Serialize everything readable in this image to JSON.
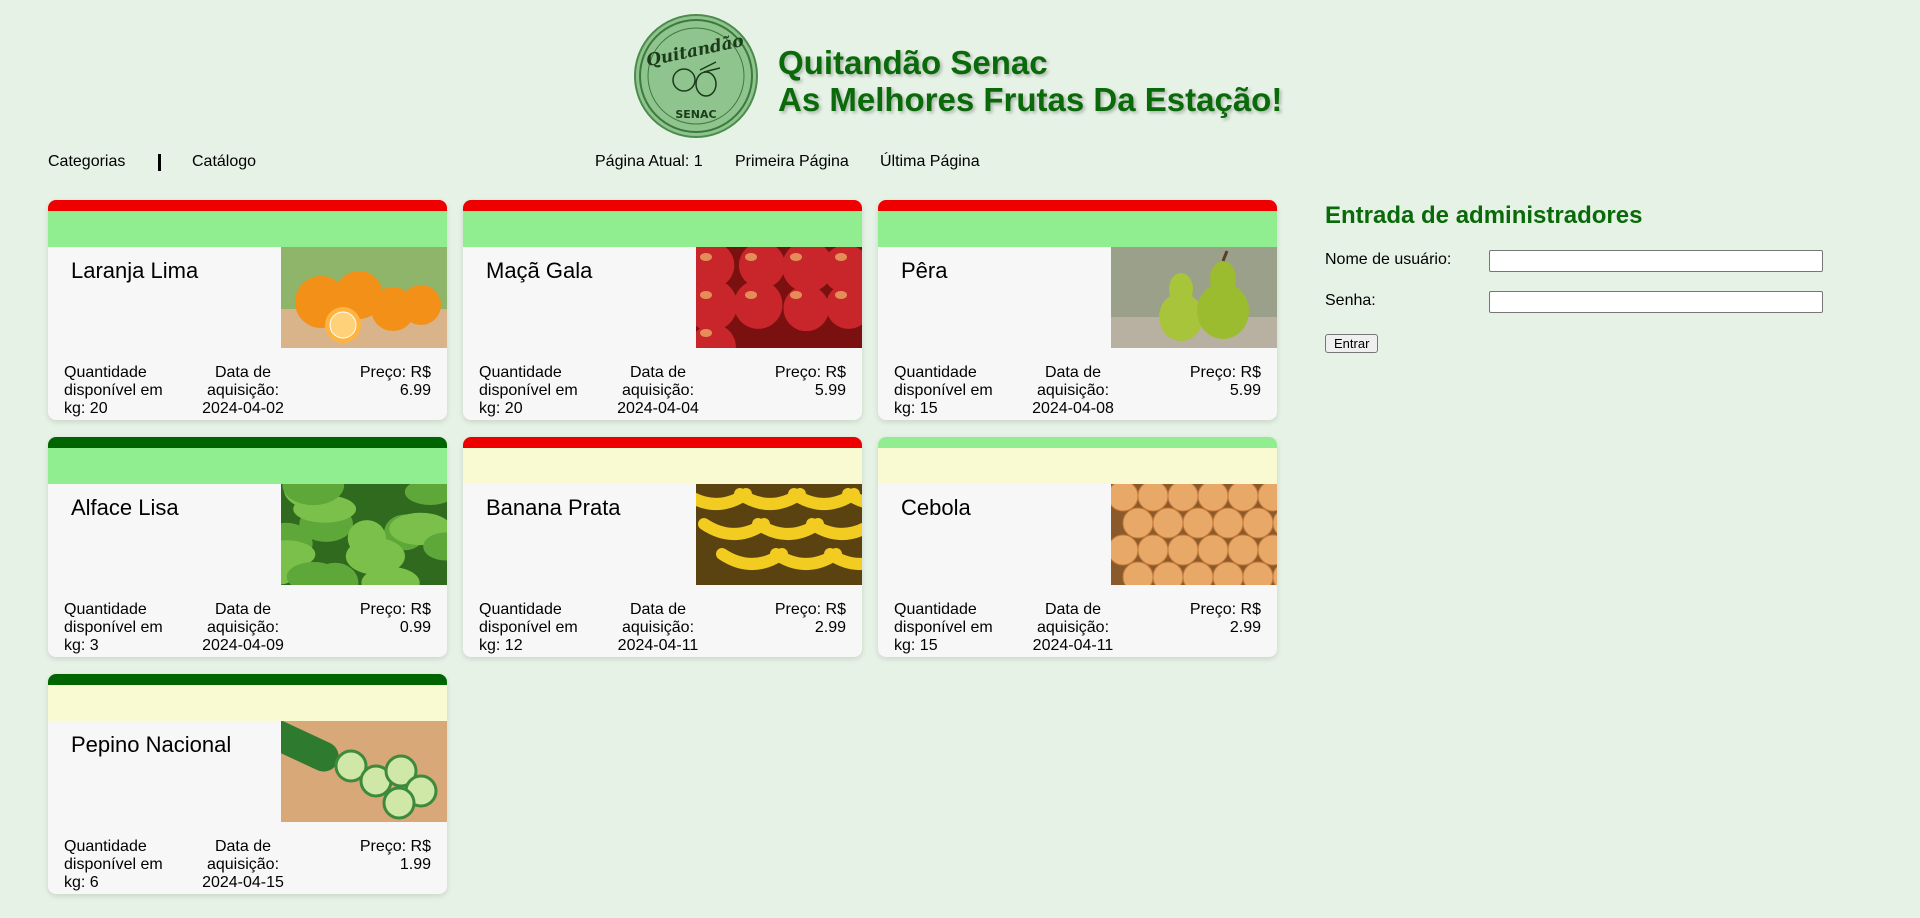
{
  "header": {
    "logo_text_top": "Quitandão",
    "logo_text_bottom": "SENAC",
    "title_line1": "Quitandão Senac",
    "title_line2": "As Melhores Frutas Da Estação!"
  },
  "nav": {
    "categories": "Categorias",
    "catalog": "Catálogo",
    "current_page": "Página Atual: 1",
    "first_page": "Primeira Página",
    "last_page": "Última Página"
  },
  "labels": {
    "qty_prefix": "Quantidade disponível em kg: ",
    "date_prefix": "Data de aquisição: ",
    "price_prefix": "Preço: R$ "
  },
  "products": [
    {
      "name": "Laranja Lima",
      "qty": "20",
      "date": "2024-04-02",
      "price": "6.99",
      "top_color": "#ee0000",
      "band_color": "#90ee90",
      "photo": "orange-photo"
    },
    {
      "name": "Maçã Gala",
      "qty": "20",
      "date": "2024-04-04",
      "price": "5.99",
      "top_color": "#ee0000",
      "band_color": "#90ee90",
      "photo": "apple-photo"
    },
    {
      "name": "Pêra",
      "qty": "15",
      "date": "2024-04-08",
      "price": "5.99",
      "top_color": "#ee0000",
      "band_color": "#90ee90",
      "photo": "pear-photo"
    },
    {
      "name": "Alface Lisa",
      "qty": "3",
      "date": "2024-04-09",
      "price": "0.99",
      "top_color": "#006400",
      "band_color": "#90ee90",
      "photo": "lettuce-photo"
    },
    {
      "name": "Banana Prata",
      "qty": "12",
      "date": "2024-04-11",
      "price": "2.99",
      "top_color": "#ee0000",
      "band_color": "#fafad2",
      "photo": "banana-photo"
    },
    {
      "name": "Cebola",
      "qty": "15",
      "date": "2024-04-11",
      "price": "2.99",
      "top_color": "#90ee90",
      "band_color": "#fafad2",
      "photo": "onion-photo"
    },
    {
      "name": "Pepino Nacional",
      "qty": "6",
      "date": "2024-04-15",
      "price": "1.99",
      "top_color": "#006400",
      "band_color": "#fafad2",
      "photo": "cucumber-photo"
    }
  ],
  "admin": {
    "title": "Entrada de administradores",
    "username_label": "Nome de usuário:",
    "password_label": "Senha:",
    "username_value": "",
    "password_value": "",
    "submit_label": "Entrar"
  }
}
